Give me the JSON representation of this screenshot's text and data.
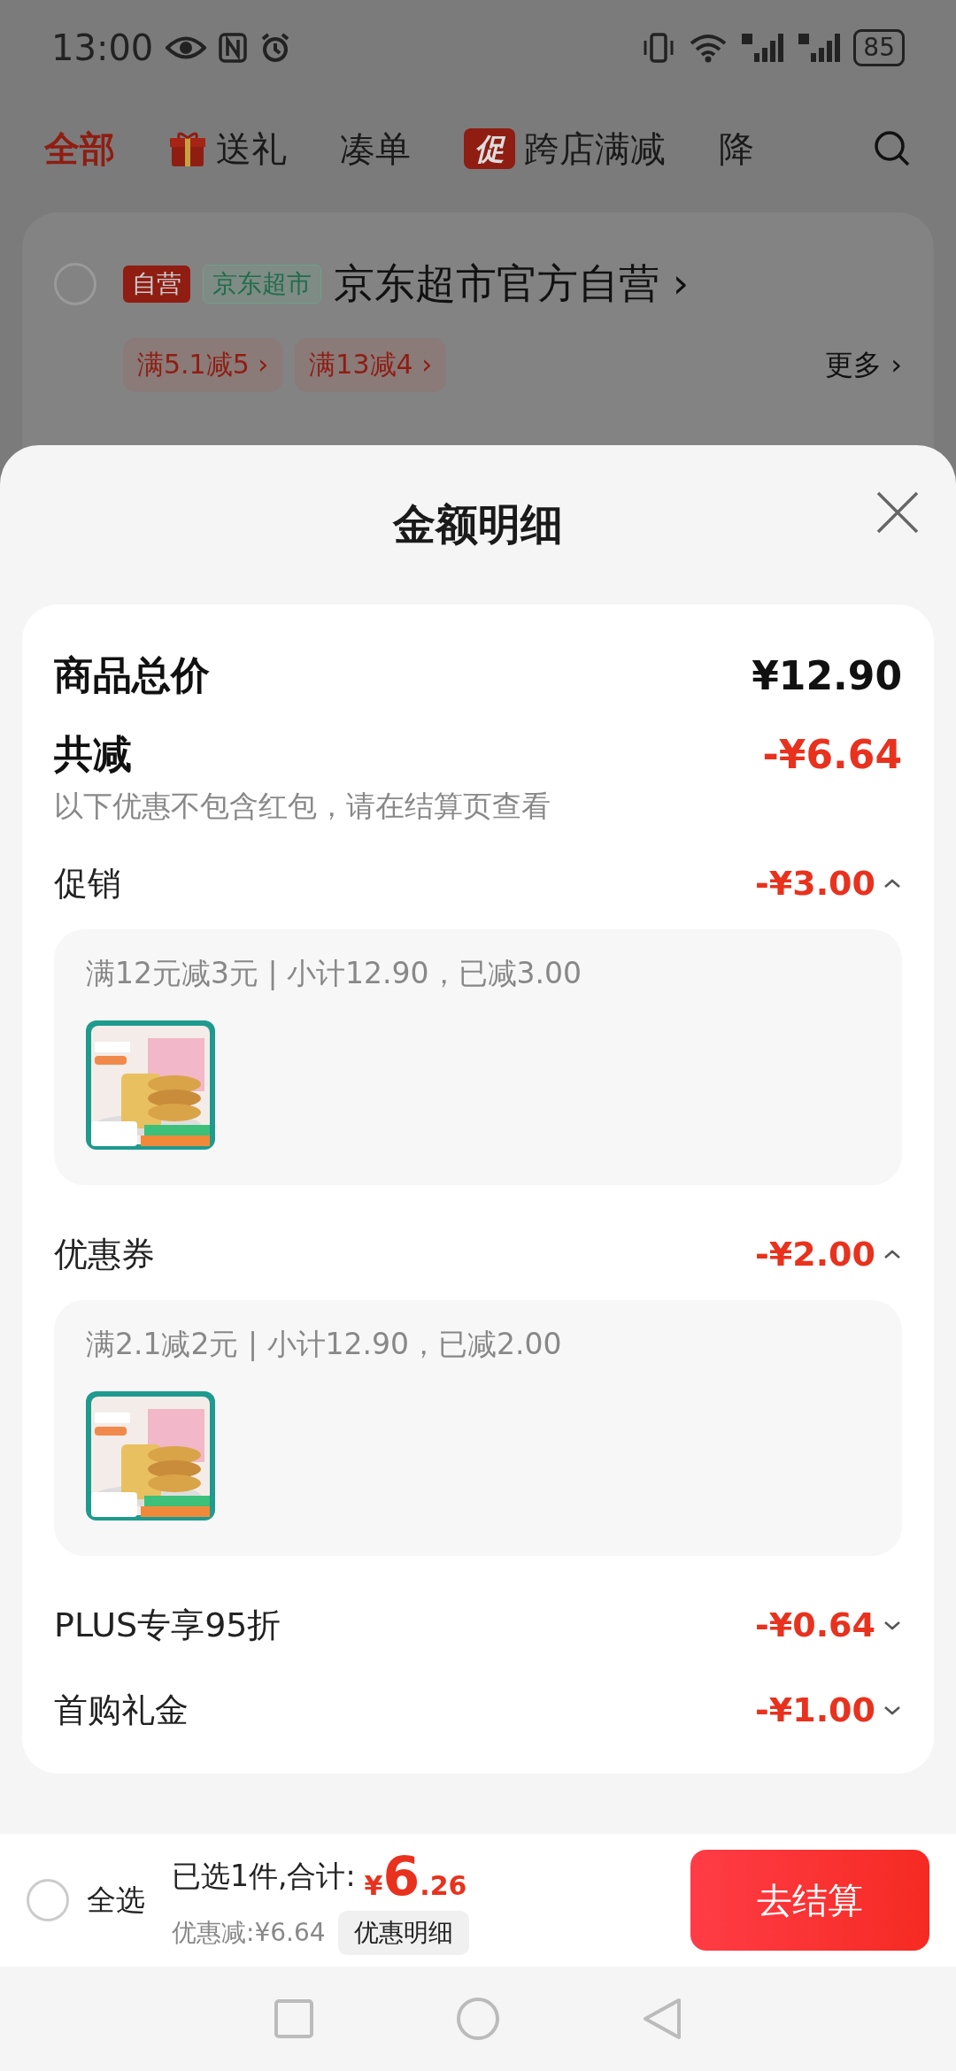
{
  "status_bar": {
    "time": "13:00",
    "battery": "85"
  },
  "tabs": [
    {
      "label": "全部",
      "kind": "plain",
      "selected": true
    },
    {
      "label": "送礼",
      "kind": "gift",
      "selected": false
    },
    {
      "label": "凑单",
      "kind": "plain",
      "selected": false
    },
    {
      "label": "跨店满减",
      "kind": "badge",
      "badge": "促",
      "selected": false
    },
    {
      "label": "降",
      "kind": "plain",
      "selected": false
    }
  ],
  "store": {
    "checked": false,
    "tags": [
      {
        "text": "自营",
        "kind": "solid"
      },
      {
        "text": "京东超市",
        "kind": "outline"
      }
    ],
    "name": "京东超市官方自营",
    "arrow": "›",
    "coupons": [
      "满5.1减5 ›",
      "满13减4 ›"
    ],
    "more": "更多 ›"
  },
  "sheet": {
    "title": "金额明细",
    "total": {
      "label": "商品总价",
      "amount": "¥12.90"
    },
    "reduced": {
      "label": "共减",
      "amount": "-¥6.64",
      "note": "以下优惠不包含红包，请在结算页查看"
    },
    "discounts": [
      {
        "label": "促销",
        "amount": "-¥3.00",
        "expanded": true,
        "rule": "满12元减3元 | 小计12.90，已减3.00"
      },
      {
        "label": "优惠券",
        "amount": "-¥2.00",
        "expanded": true,
        "rule": "满2.1减2元 | 小计12.90，已减2.00"
      },
      {
        "label": "PLUS专享95折",
        "amount": "-¥0.64",
        "expanded": false
      },
      {
        "label": "首购礼金",
        "amount": "-¥1.00",
        "expanded": false
      }
    ]
  },
  "bottom_bar": {
    "select_all": {
      "label": "全选",
      "checked": false
    },
    "summary": "已选1件,合计:",
    "currency": "¥",
    "total_int": "6",
    "total_dec": ".26",
    "saved": "优惠减:¥6.64",
    "detail_button": "优惠明细",
    "checkout": "去结算"
  }
}
